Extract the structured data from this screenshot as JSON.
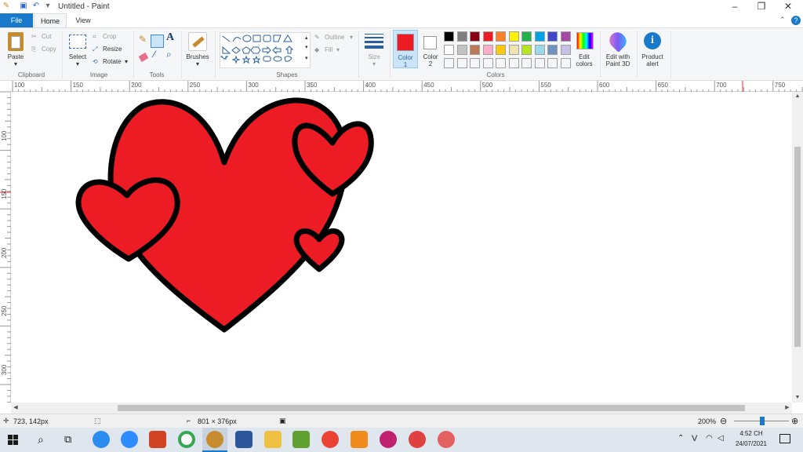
{
  "window": {
    "title": "Untitled - Paint"
  },
  "tabs": [
    {
      "label": "File"
    },
    {
      "label": "Home"
    },
    {
      "label": "View"
    }
  ],
  "ribbon": {
    "clipboard": {
      "paste": "Paste",
      "cut": "Cut",
      "copy": "Copy",
      "group": "Clipboard"
    },
    "image": {
      "select": "Select",
      "crop": "Crop",
      "resize": "Resize",
      "rotate": "Rotate",
      "group": "Image"
    },
    "tools": {
      "group": "Tools"
    },
    "brushes": {
      "label": "Brushes"
    },
    "shapes": {
      "outline": "Outline",
      "fill": "Fill",
      "group": "Shapes"
    },
    "size": {
      "label": "Size"
    },
    "colors": {
      "color1_label_1": "Color",
      "color1_label_2": "1",
      "color2_label_1": "Color",
      "color2_label_2": "2",
      "color1": "#ed1c24",
      "color2": "#ffffff",
      "palette_row1": [
        "#000000",
        "#7f7f7f",
        "#880015",
        "#ed1c24",
        "#ff7f27",
        "#fff200",
        "#22b14c",
        "#00a2e8",
        "#3f48cc",
        "#a349a4"
      ],
      "palette_row2": [
        "#ffffff",
        "#c3c3c3",
        "#b97a57",
        "#ffaec9",
        "#ffc90e",
        "#efe4b0",
        "#b5e61d",
        "#99d9ea",
        "#7092be",
        "#c8bfe7"
      ],
      "edit_1": "Edit",
      "edit_2": "colors",
      "group": "Colors"
    },
    "paint3d": {
      "l1": "Edit with",
      "l2": "Paint 3D"
    },
    "alert": {
      "l1": "Product",
      "l2": "alert"
    }
  },
  "ruler_top": [
    "100",
    "150",
    "200",
    "250",
    "300",
    "350",
    "400",
    "450",
    "500",
    "550",
    "600",
    "650",
    "700",
    "750"
  ],
  "ruler_left": [
    "100",
    "150",
    "200",
    "250",
    "300"
  ],
  "status": {
    "cursor": "723, 142px",
    "size": "801 × 376px",
    "zoom": "200%"
  },
  "taskbar": {
    "lang": "V",
    "time": "4:52 CH",
    "date": "24/07/2021"
  }
}
